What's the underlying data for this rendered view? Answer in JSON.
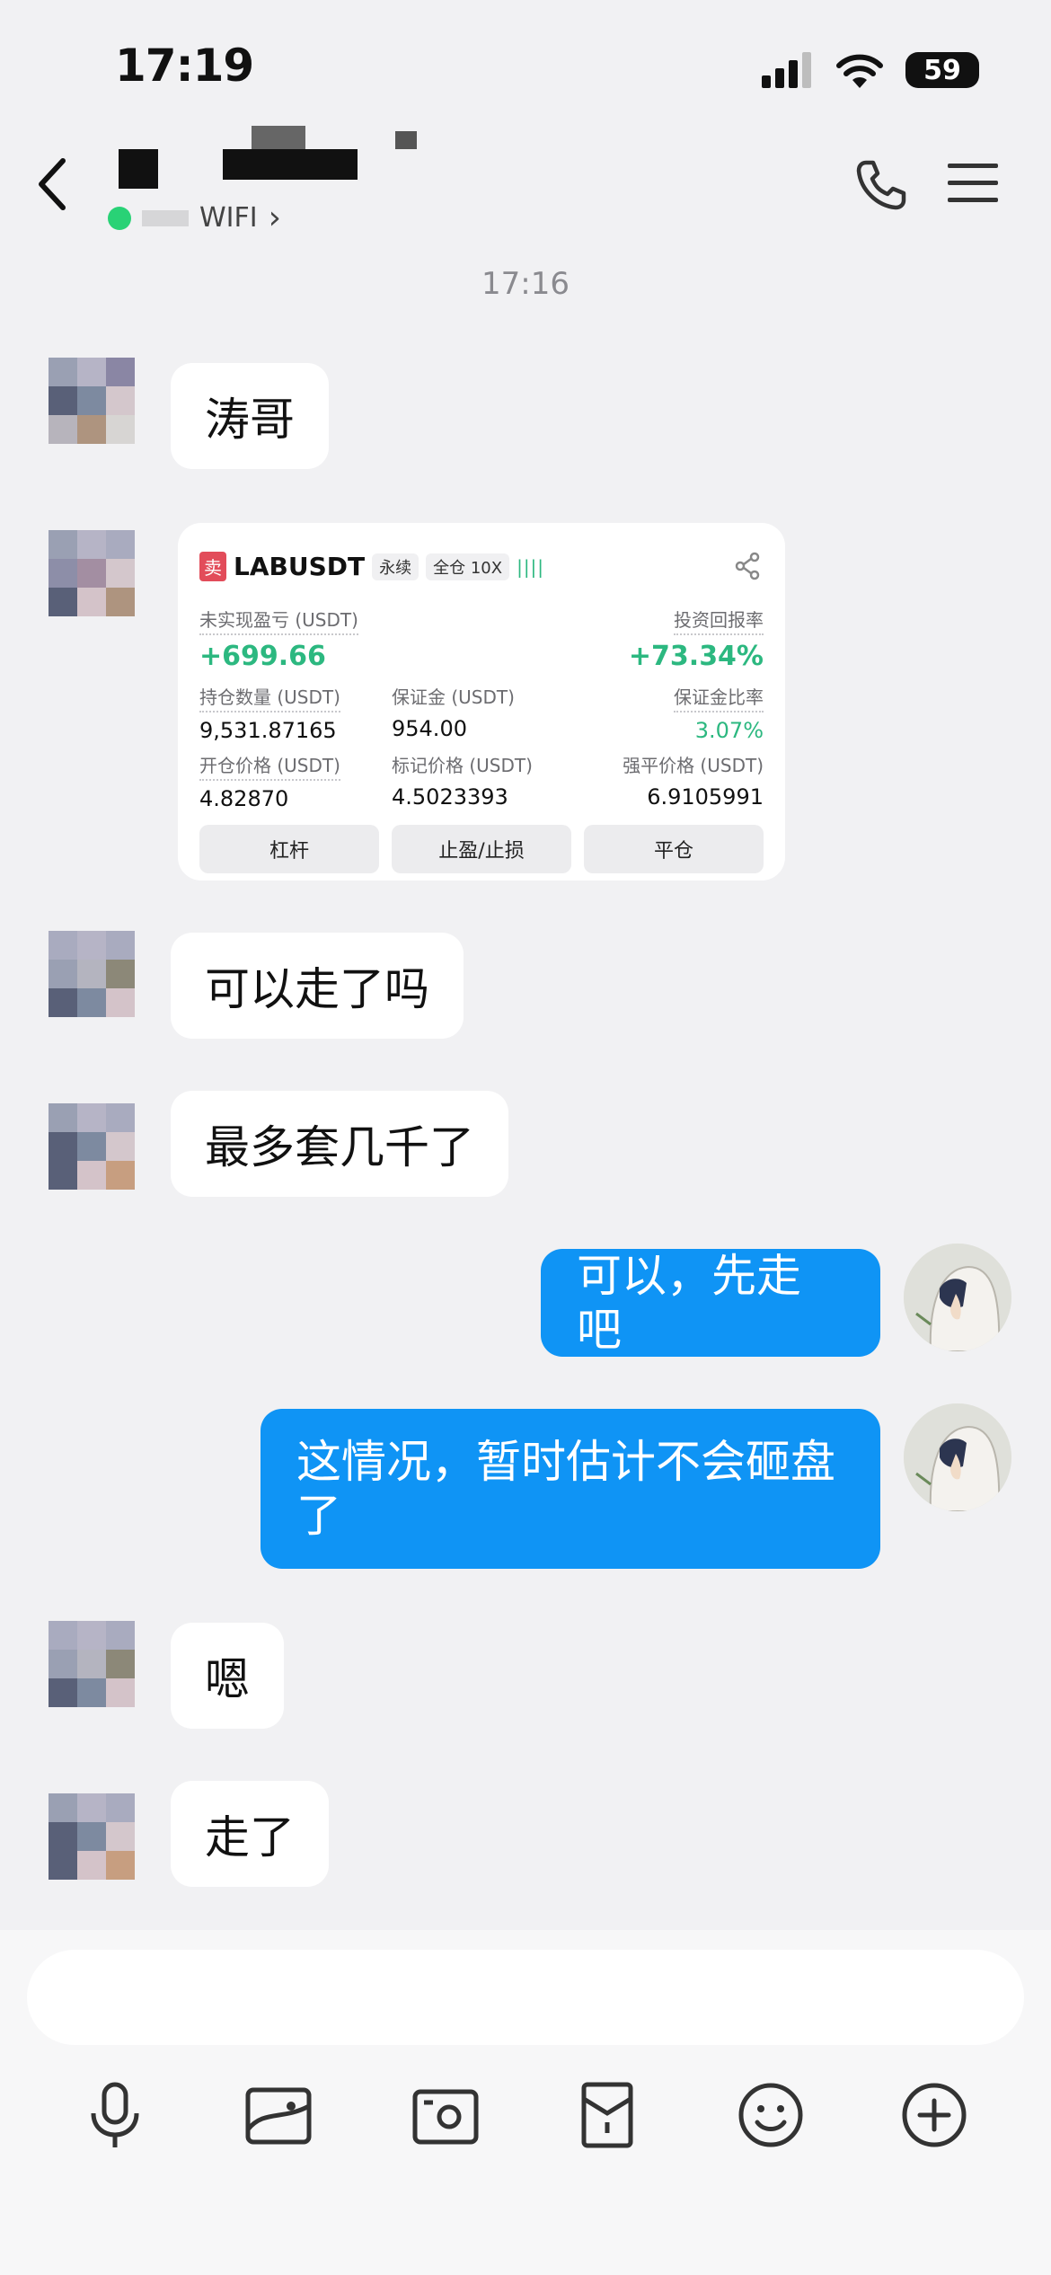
{
  "status": {
    "time": "17:19",
    "battery": "59"
  },
  "header": {
    "online_label": "WIFI",
    "online_chevron": "›"
  },
  "chat": {
    "timestamp": "17:16",
    "messages": [
      {
        "from": "them",
        "text": "涛哥"
      },
      {
        "from": "them",
        "text": "可以走了吗"
      },
      {
        "from": "them",
        "text": "最多套几千了"
      },
      {
        "from": "me",
        "text": "可以，先走吧"
      },
      {
        "from": "me",
        "text": "这情况，暂时估计不会砸盘了"
      },
      {
        "from": "them",
        "text": "嗯"
      },
      {
        "from": "them",
        "text": "走了"
      }
    ]
  },
  "trade_card": {
    "side": "卖",
    "symbol": "LABUSDT",
    "type_tag": "永续",
    "margin_tag": "全仓 10X",
    "unrealized_pnl_label": "未实现盈亏 (USDT)",
    "unrealized_pnl": "+699.66",
    "roi_label": "投资回报率",
    "roi": "+73.34%",
    "position_label": "持仓数量 (USDT)",
    "position": "9,531.87165",
    "margin_label": "保证金 (USDT)",
    "margin": "954.00",
    "margin_ratio_label": "保证金比率",
    "margin_ratio": "3.07%",
    "entry_label": "开仓价格 (USDT)",
    "entry": "4.82870",
    "mark_label": "标记价格 (USDT)",
    "mark": "4.5023393",
    "liq_label": "强平价格 (USDT)",
    "liq": "6.9105991",
    "buttons": [
      "杠杆",
      "止盈/止损",
      "平仓"
    ]
  },
  "input": {
    "placeholder": ""
  },
  "colors": {
    "outgoing_bubble": "#0f94f5",
    "profit_green": "#2cb880",
    "online_dot": "#29d276"
  }
}
